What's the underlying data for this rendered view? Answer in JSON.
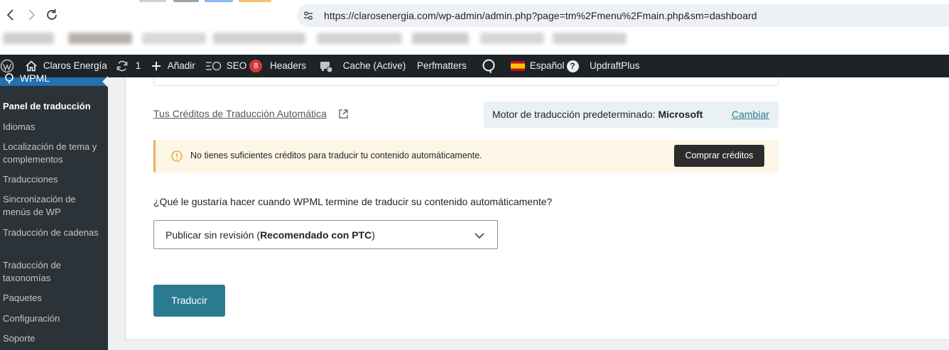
{
  "browser": {
    "url": "https://clarosenergia.com/wp-admin/admin.php?page=tm%2Fmenu%2Fmain.php&sm=dashboard",
    "back_icon": "chevron-left",
    "forward_icon": "chevron-right",
    "reload_icon": "reload",
    "tab_colors": [
      "#c8d4cc",
      "#9aa3a8",
      "#8ab4f8",
      "#f6c26b"
    ]
  },
  "adminbar": {
    "site_name": "Claros Energía",
    "updates_count": "1",
    "add_new": "Añadir",
    "seo_label": "SEO",
    "seo_badge": "8",
    "headers": "Headers",
    "cache": "Cache (Active)",
    "perfmatters": "Perfmatters",
    "language": "Español",
    "help": "?",
    "updraft": "UpdraftPlus"
  },
  "sidebar": {
    "parent_label": "WPML",
    "items": [
      "Panel de traducción",
      "Idiomas",
      "Localización de tema y complementos",
      "Traducciones",
      "Sincronización de menús de WP",
      "Traducción de cadenas",
      "Traducción de taxonomías",
      "Paquetes",
      "Configuración",
      "Soporte"
    ],
    "current_index": 0
  },
  "main": {
    "credits_link": "Tus Créditos de Traducción Automática",
    "engine_label": "Motor de traducción predeterminado: ",
    "engine_value": "Microsoft",
    "change_link": "Cambiar",
    "notice_text": "No tienes suficientes créditos para traducir tu contenido automáticamente.",
    "buy_button": "Comprar créditos",
    "question": "¿Qué le gustaría hacer cuando WPML termine de traducir su contenido automáticamente?",
    "select_value_prefix": "Publicar sin revisión (",
    "select_value_bold": "Recomendado con PTC",
    "select_value_suffix": ")",
    "translate_button": "Traducir"
  },
  "colors": {
    "admin_bar": "#1d2327",
    "sidebar": "#2c3338",
    "accent_teal": "#2a7b8f",
    "wpml_blue": "#2271b1",
    "notice_bg": "#fdf5e6",
    "notice_border": "#e4b46a",
    "seo_badge": "#d63638"
  }
}
